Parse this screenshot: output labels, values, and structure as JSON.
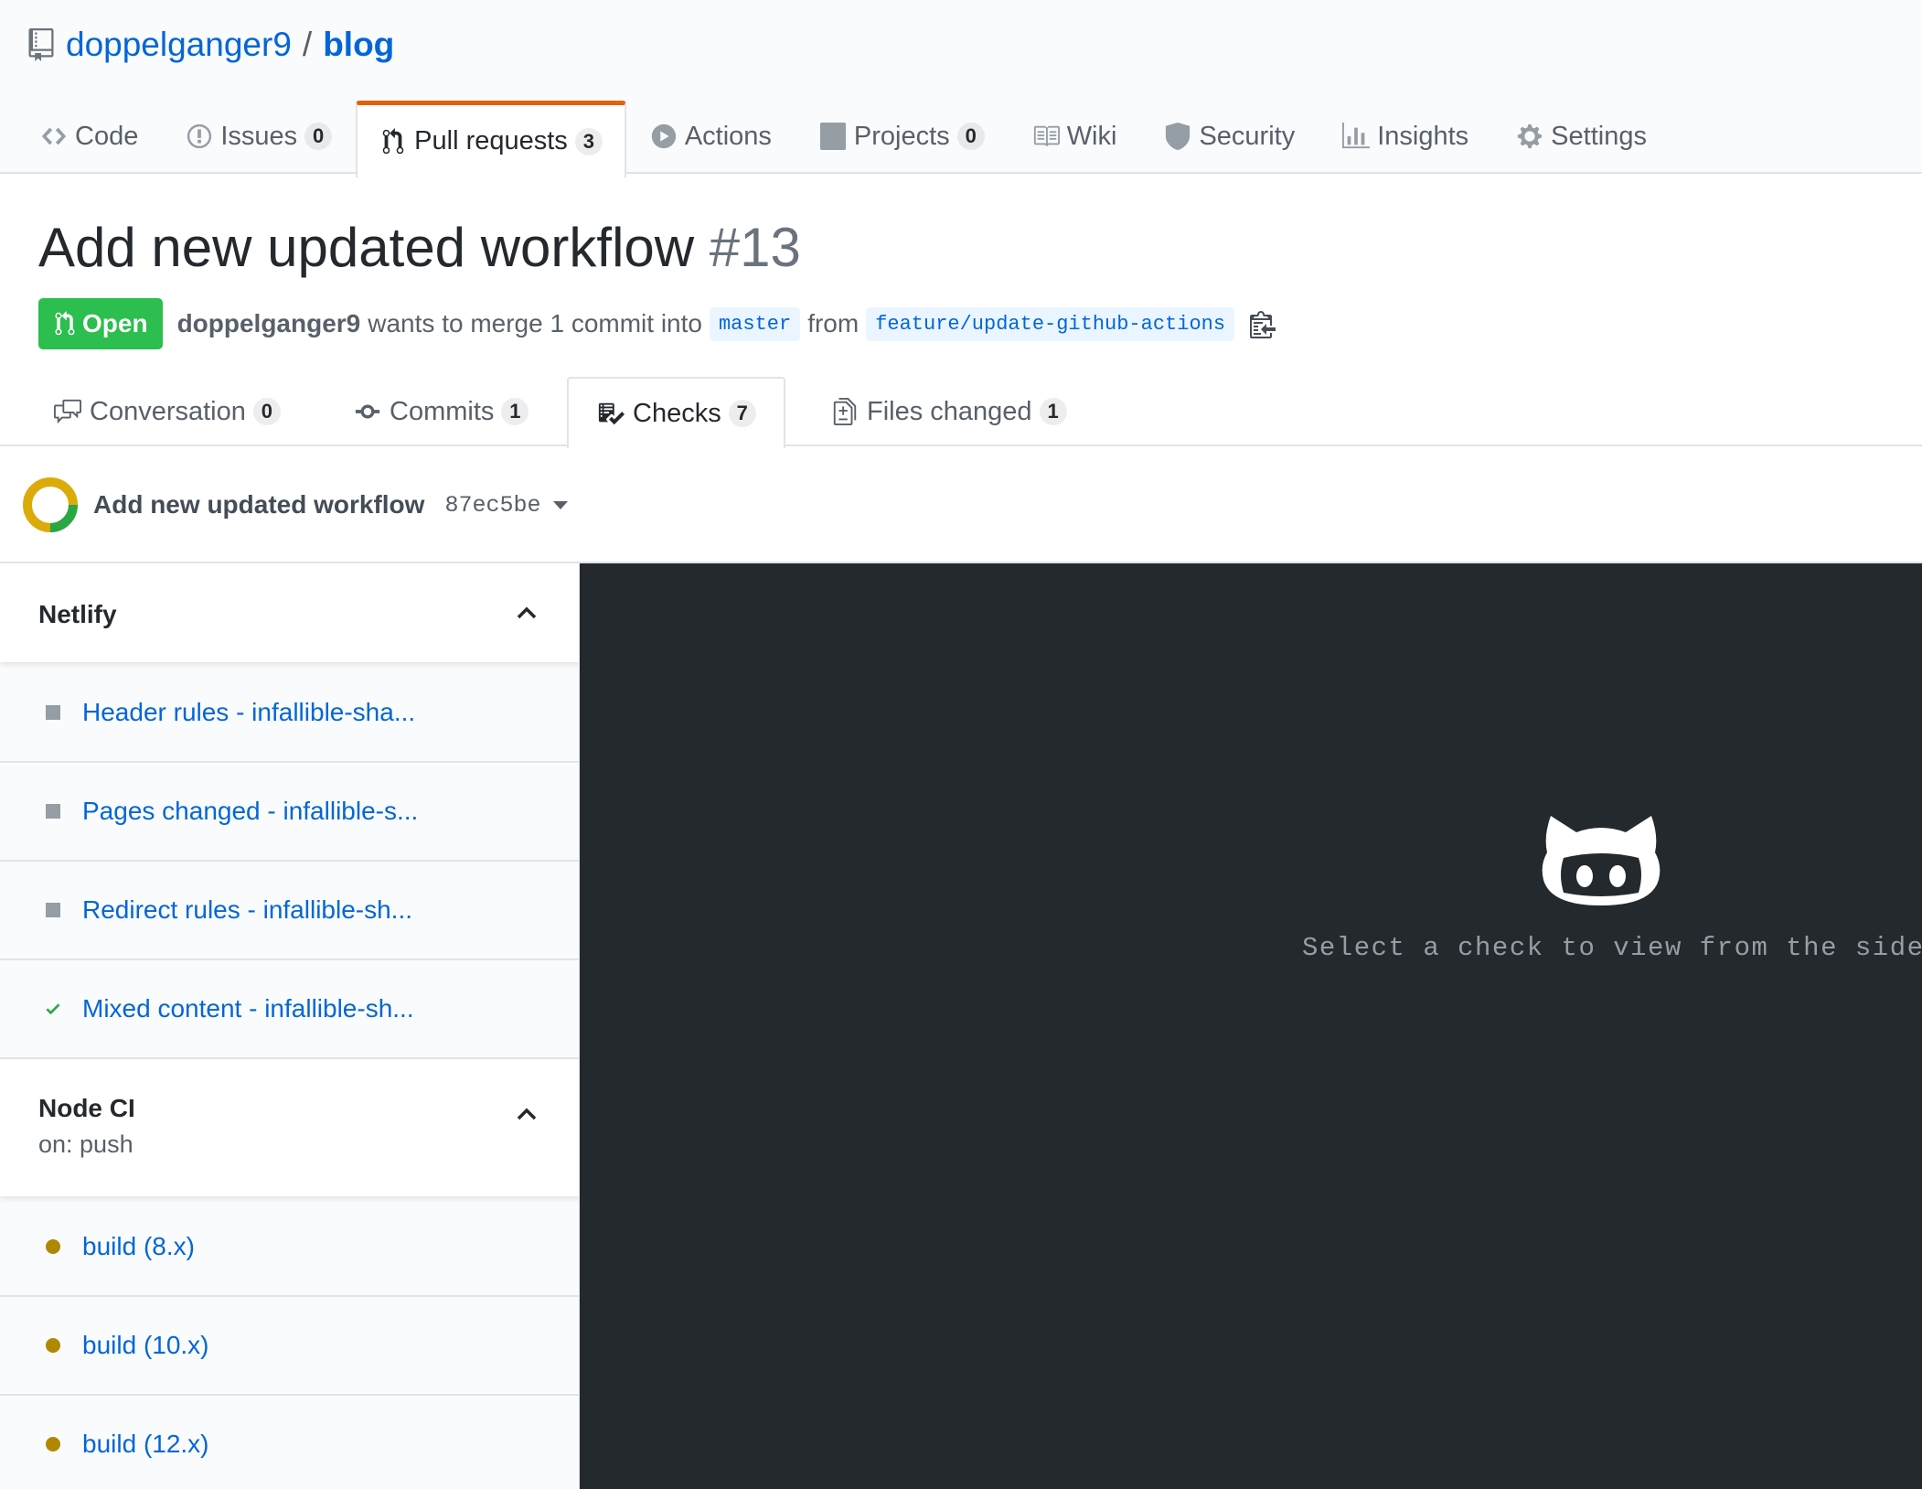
{
  "repo": {
    "owner": "doppelganger9",
    "separator": "/",
    "name": "blog"
  },
  "reponav": [
    {
      "label": "Code",
      "icon": "code-icon",
      "counter": null,
      "selected": false
    },
    {
      "label": "Issues",
      "icon": "issue-opened-icon",
      "counter": "0",
      "selected": false
    },
    {
      "label": "Pull requests",
      "icon": "git-pull-request-icon",
      "counter": "3",
      "selected": true
    },
    {
      "label": "Actions",
      "icon": "play-icon",
      "counter": null,
      "selected": false
    },
    {
      "label": "Projects",
      "icon": "project-icon",
      "counter": "0",
      "selected": false
    },
    {
      "label": "Wiki",
      "icon": "book-icon",
      "counter": null,
      "selected": false
    },
    {
      "label": "Security",
      "icon": "shield-icon",
      "counter": null,
      "selected": false
    },
    {
      "label": "Insights",
      "icon": "graph-icon",
      "counter": null,
      "selected": false
    },
    {
      "label": "Settings",
      "icon": "gear-icon",
      "counter": null,
      "selected": false
    }
  ],
  "pr": {
    "title": "Add new updated workflow",
    "number": "#13",
    "state": "Open",
    "author": "doppelganger9",
    "merge_text": "wants to merge 1 commit into",
    "base_branch": "master",
    "from_text": "from",
    "head_branch": "feature/update-github-actions"
  },
  "prnav": [
    {
      "label": "Conversation",
      "icon": "comment-discussion-icon",
      "counter": "0",
      "selected": false
    },
    {
      "label": "Commits",
      "icon": "git-commit-icon",
      "counter": "1",
      "selected": false
    },
    {
      "label": "Checks",
      "icon": "checklist-icon",
      "counter": "7",
      "selected": true
    },
    {
      "label": "Files changed",
      "icon": "file-diff-icon",
      "counter": "1",
      "selected": false
    }
  ],
  "suite": {
    "commit_title": "Add new updated workflow",
    "sha": "87ec5be",
    "status": "in-progress",
    "ring_colors": {
      "pending": "#dbab09",
      "success": "#28a745"
    }
  },
  "groups": [
    {
      "title": "Netlify",
      "subtitle": "",
      "expanded": true,
      "checks": [
        {
          "label": "Header rules - infallible-sha...",
          "status": "neutral"
        },
        {
          "label": "Pages changed - infallible-s...",
          "status": "neutral"
        },
        {
          "label": "Redirect rules - infallible-sh...",
          "status": "neutral"
        },
        {
          "label": "Mixed content - infallible-sh...",
          "status": "success"
        }
      ]
    },
    {
      "title": "Node CI",
      "subtitle": "on: push",
      "expanded": true,
      "checks": [
        {
          "label": "build (8.x)",
          "status": "pending"
        },
        {
          "label": "build (10.x)",
          "status": "pending"
        },
        {
          "label": "build (12.x)",
          "status": "pending"
        }
      ]
    }
  ],
  "log_panel": {
    "icon": "octocat-icon",
    "message": "Select a check to view from the sidebar"
  },
  "colors": {
    "link": "#0366d6",
    "open_state": "#2cbe4e",
    "tab_accent": "#e36209",
    "success": "#28a745",
    "pending": "#b08800",
    "neutral": "#959da5",
    "log_bg": "#24292e"
  }
}
